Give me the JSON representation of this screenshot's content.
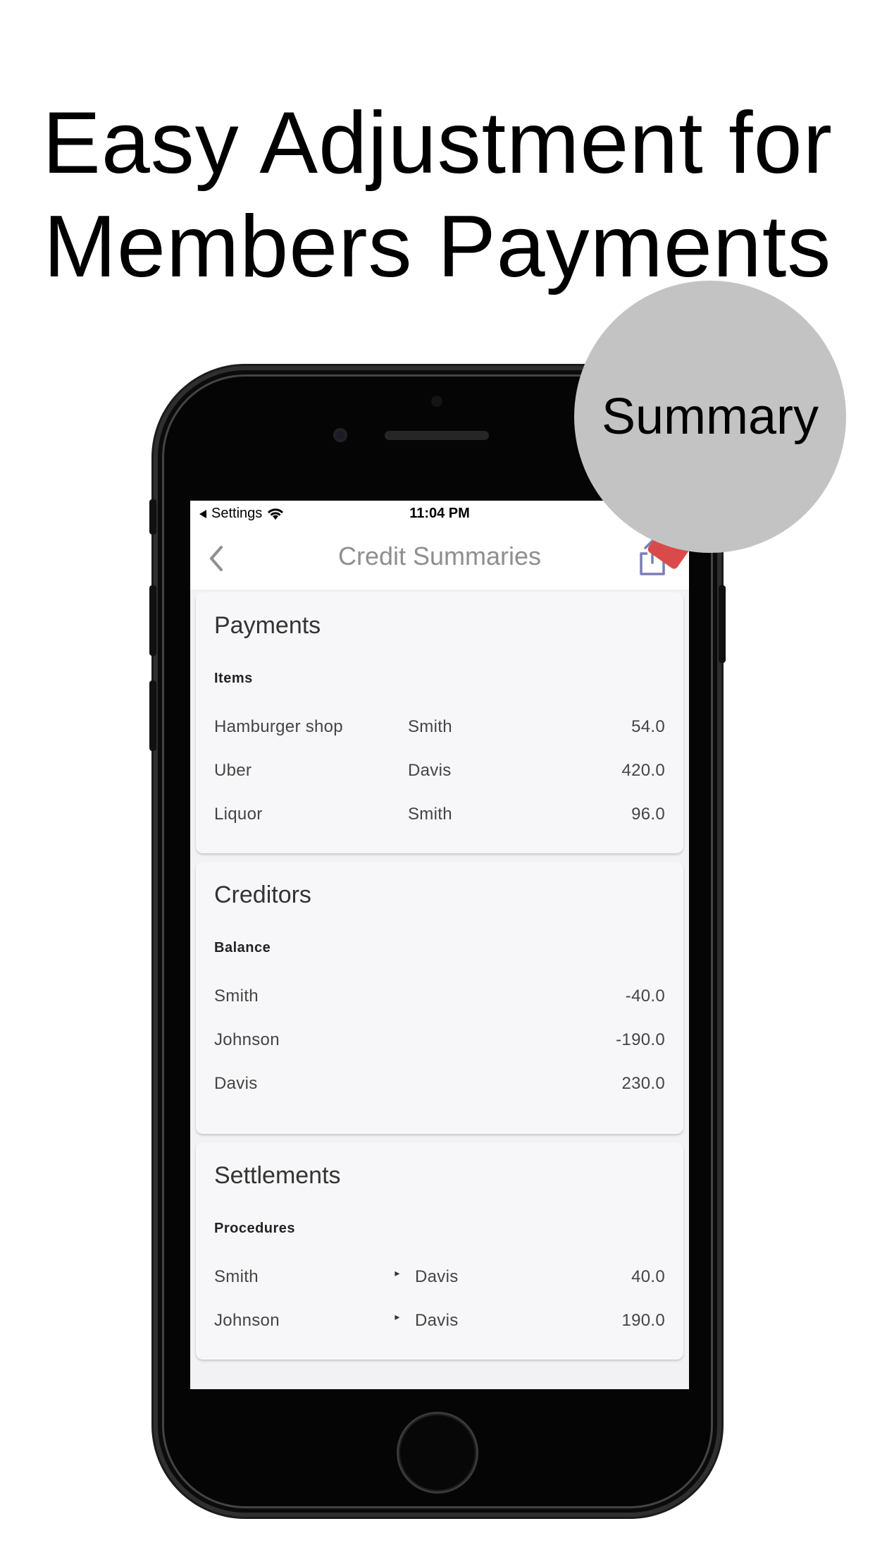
{
  "headline": {
    "line1": "Easy Adjustment for",
    "line2": "Members Payments"
  },
  "bubble_label": "Summary",
  "status_bar": {
    "back_app": "Settings",
    "time": "11:04 PM",
    "back_icon": "triangle-left-icon",
    "wifi_icon": "wifi-icon"
  },
  "nav": {
    "title": "Credit Summaries",
    "back_icon": "chevron-left-icon",
    "share_icon": "share-icon"
  },
  "payments": {
    "title": "Payments",
    "subheader": "Items",
    "rows": [
      {
        "item": "Hamburger shop",
        "payer": "Smith",
        "amount": "54.0"
      },
      {
        "item": "Uber",
        "payer": "Davis",
        "amount": "420.0"
      },
      {
        "item": "Liquor",
        "payer": "Smith",
        "amount": "96.0"
      }
    ]
  },
  "creditors": {
    "title": "Creditors",
    "subheader": "Balance",
    "rows": [
      {
        "name": "Smith",
        "balance": "-40.0"
      },
      {
        "name": "Johnson",
        "balance": "-190.0"
      },
      {
        "name": "Davis",
        "balance": "230.0"
      }
    ]
  },
  "settlements": {
    "title": "Settlements",
    "subheader": "Procedures",
    "rows": [
      {
        "from": "Smith",
        "to": "Davis",
        "amount": "40.0"
      },
      {
        "from": "Johnson",
        "to": "Davis",
        "amount": "190.0"
      }
    ]
  },
  "colors": {
    "bubble": "#c3c3c3",
    "accent_share": "#7a7fb5",
    "badge": "#d94b4b"
  }
}
